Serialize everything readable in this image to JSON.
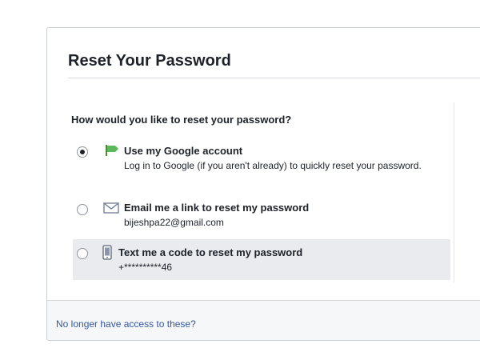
{
  "dialog": {
    "title": "Reset Your Password",
    "question": "How would you like to reset your password?",
    "options": [
      {
        "title": "Use my Google account",
        "description": "Log in to Google (if you aren't already) to quickly reset your password.",
        "selected": true,
        "icon": "google-flag-icon"
      },
      {
        "title": "Email me a link to reset my password",
        "description": "bijeshpa22@gmail.com",
        "selected": false,
        "icon": "envelope-icon"
      },
      {
        "title": "Text me a code to reset my password",
        "description": "+**********46",
        "selected": false,
        "icon": "mobile-phone-icon"
      }
    ],
    "footer_link": "No longer have access to these?"
  },
  "colors": {
    "text": "#1d2129",
    "link": "#365899",
    "highlight_row": "#e9ebee",
    "footer_bg": "#f6f7f9",
    "google_icon": "#5cb85c"
  }
}
